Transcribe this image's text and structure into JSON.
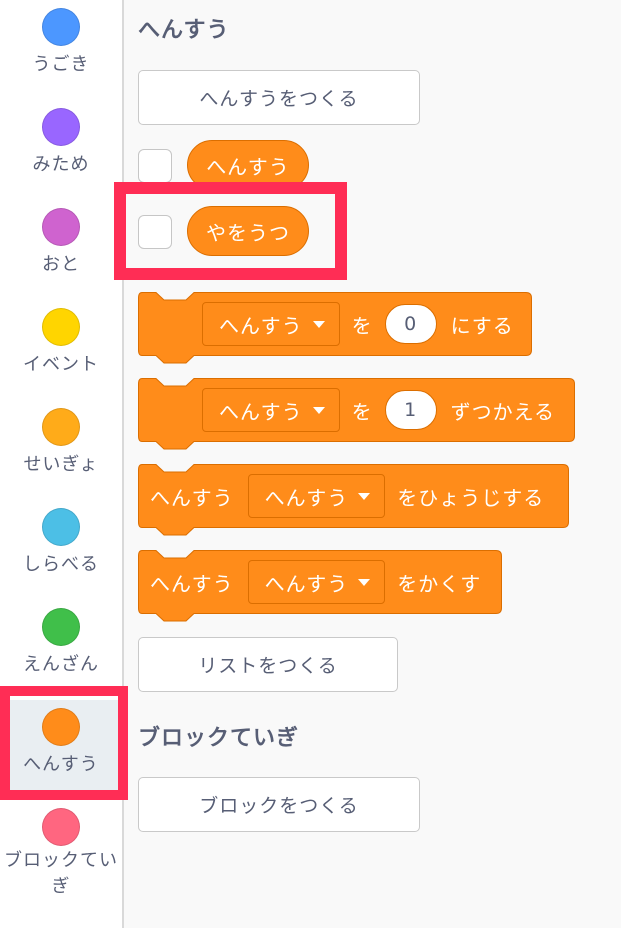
{
  "sidebar": {
    "categories": [
      {
        "label": "うごき",
        "color": "#4c97ff"
      },
      {
        "label": "みため",
        "color": "#9966ff"
      },
      {
        "label": "おと",
        "color": "#cf63cf"
      },
      {
        "label": "イベント",
        "color": "#ffd500"
      },
      {
        "label": "せいぎょ",
        "color": "#ffab19"
      },
      {
        "label": "しらべる",
        "color": "#4cbfe6"
      },
      {
        "label": "えんざん",
        "color": "#40bf4a"
      },
      {
        "label": "へんすう",
        "color": "#ff8c1a"
      },
      {
        "label": "ブロックていぎ",
        "color": "#ff6680"
      }
    ],
    "selected": "へんすう"
  },
  "palette": {
    "variables_title": "へんすう",
    "make_variable_button": "へんすうをつくる",
    "variables": [
      {
        "name": "へんすう",
        "checked": false
      },
      {
        "name": "やをうつ",
        "checked": false
      }
    ],
    "blocks": {
      "set": {
        "dropdown": "へんすう",
        "text1": "を",
        "value": "0",
        "text2": "にする"
      },
      "change": {
        "dropdown": "へんすう",
        "text1": "を",
        "value": "1",
        "text2": "ずつかえる"
      },
      "show": {
        "text1": "へんすう",
        "dropdown": "へんすう",
        "text2": "をひょうじする"
      },
      "hide": {
        "text1": "へんすう",
        "dropdown": "へんすう",
        "text2": "をかくす"
      }
    },
    "make_list_button": "リストをつくる",
    "my_blocks_title": "ブロックていぎ",
    "make_block_button": "ブロックをつくる"
  },
  "colors": {
    "accent": "#ff8c1a",
    "accent_border": "#db6e00",
    "highlight": "#ff2d55"
  }
}
